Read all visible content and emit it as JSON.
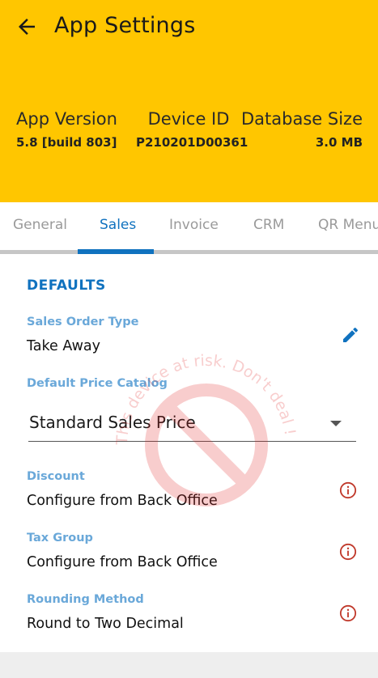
{
  "header": {
    "title": "App Settings",
    "back_icon": "arrow-left-icon",
    "bg_color": "#FFC600"
  },
  "stats": {
    "version": {
      "label": "App Version",
      "value": "5.8 [build 803]"
    },
    "device": {
      "label": "Device ID",
      "value": "P210201D00361"
    },
    "database": {
      "label": "Database Size",
      "value": "3.0 MB"
    }
  },
  "tabs": [
    {
      "label": "General",
      "active": false
    },
    {
      "label": "Sales",
      "active": true
    },
    {
      "label": "Invoice",
      "active": false
    },
    {
      "label": "CRM",
      "active": false
    },
    {
      "label": "QR Menu",
      "active": false
    }
  ],
  "defaults": {
    "section_title": "DEFAULTS",
    "sales_order_type": {
      "label": "Sales Order Type",
      "value": "Take Away",
      "icon": "edit-pencil-icon"
    },
    "price_catalog": {
      "label": "Default Price Catalog",
      "value": "Standard Sales Price"
    },
    "discount": {
      "label": "Discount",
      "value": "Configure from Back Office",
      "icon": "info-icon"
    },
    "tax_group": {
      "label": "Tax Group",
      "value": "Configure from Back Office",
      "icon": "info-icon"
    },
    "rounding": {
      "label": "Rounding Method",
      "value": "Round to Two Decimal",
      "icon": "info-icon"
    }
  },
  "watermark": {
    "text": "This device at risk. Don't deal !"
  },
  "colors": {
    "accent": "#1072bf",
    "label": "#6aa8d9",
    "warning": "#c0392b"
  }
}
